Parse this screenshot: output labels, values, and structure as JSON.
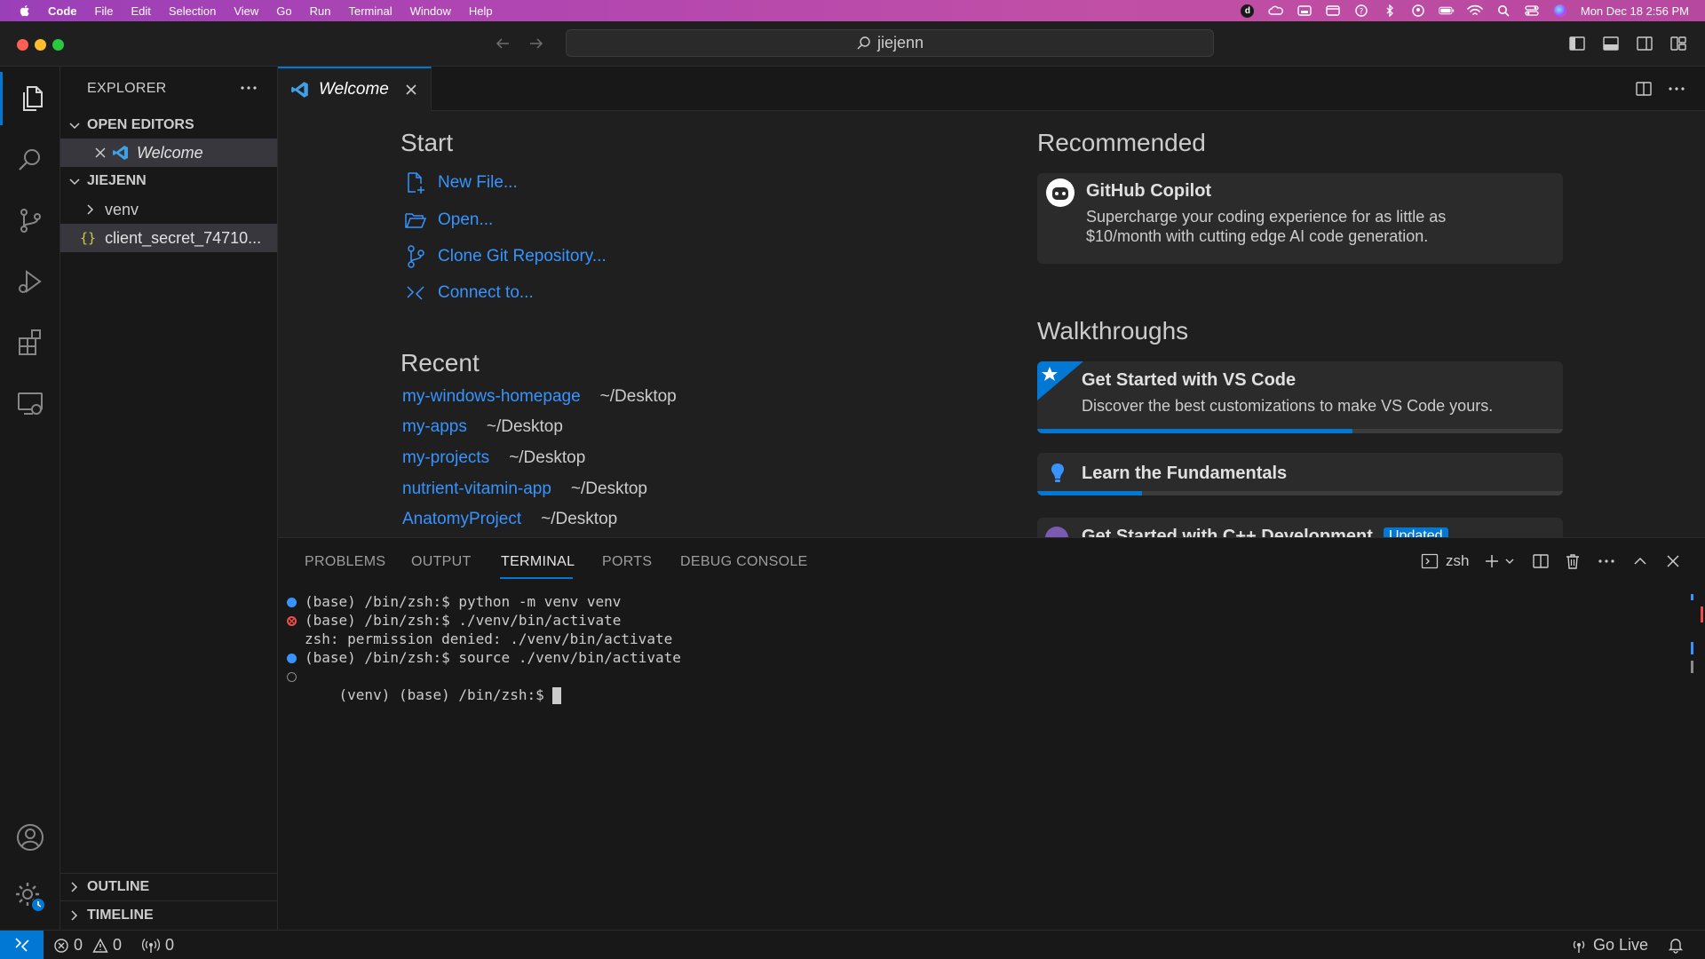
{
  "menubar": {
    "items": [
      "Code",
      "File",
      "Edit",
      "Selection",
      "View",
      "Go",
      "Run",
      "Terminal",
      "Window",
      "Help"
    ],
    "datetime": "Mon Dec 18  2:56 PM",
    "status_icon_letter": "d"
  },
  "titlebar": {
    "search_text": "jiejenn"
  },
  "sidebar": {
    "title": "EXPLORER",
    "open_editors_header": "OPEN EDITORS",
    "open_editor_item": "Welcome",
    "folder_header": "JIEJENN",
    "tree": [
      {
        "label": "venv",
        "icon": "chevron-right-icon"
      },
      {
        "label": "client_secret_74710...",
        "icon": "json-icon"
      }
    ],
    "outline_header": "OUTLINE",
    "timeline_header": "TIMELINE"
  },
  "tabs": {
    "active_label": "Welcome"
  },
  "welcome": {
    "start_title": "Start",
    "start_items": [
      {
        "label": "New File...",
        "icon": "new-file-icon"
      },
      {
        "label": "Open...",
        "icon": "folder-open-icon"
      },
      {
        "label": "Clone Git Repository...",
        "icon": "source-control-icon"
      },
      {
        "label": "Connect to...",
        "icon": "remote-icon"
      }
    ],
    "recent_title": "Recent",
    "recent_items": [
      {
        "name": "my-windows-homepage",
        "path": "~/Desktop"
      },
      {
        "name": "my-apps",
        "path": "~/Desktop"
      },
      {
        "name": "my-projects",
        "path": "~/Desktop"
      },
      {
        "name": "nutrient-vitamin-app",
        "path": "~/Desktop"
      },
      {
        "name": "AnatomyProject",
        "path": "~/Desktop"
      }
    ],
    "recommended_title": "Recommended",
    "copilot": {
      "title": "GitHub Copilot",
      "description": "Supercharge your coding experience for as little as $10/month with cutting edge AI code generation."
    },
    "walkthroughs_title": "Walkthroughs",
    "walkthroughs": [
      {
        "title": "Get Started with VS Code",
        "description": "Discover the best customizations to make VS Code yours.",
        "progress": 0.6
      },
      {
        "title": "Learn the Fundamentals",
        "description": "",
        "progress": 0.2
      },
      {
        "title": "Get Started with C++ Development",
        "badge": "Updated"
      }
    ]
  },
  "panel": {
    "tabs": [
      "PROBLEMS",
      "OUTPUT",
      "TERMINAL",
      "PORTS",
      "DEBUG CONSOLE"
    ],
    "active_tab": "TERMINAL",
    "shell_label": "zsh",
    "terminal_lines": [
      {
        "text": "(base) /bin/zsh:$ python -m venv venv",
        "status": "success"
      },
      {
        "text": "(base) /bin/zsh:$ ./venv/bin/activate",
        "status": "error"
      },
      {
        "text": "zsh: permission denied: ./venv/bin/activate",
        "status": "none"
      },
      {
        "text": "(base) /bin/zsh:$ source ./venv/bin/activate",
        "status": "success"
      },
      {
        "text": "(venv) (base) /bin/zsh:$ ",
        "status": "pending"
      }
    ]
  },
  "statusbar": {
    "errors": "0",
    "warnings": "0",
    "ports": "0",
    "go_live": "Go Live"
  },
  "colors": {
    "accent": "#0078d4",
    "link": "#3794ff",
    "menubar_gradient_start": "#9b3fb8",
    "menubar_gradient_end": "#c14fa5"
  }
}
